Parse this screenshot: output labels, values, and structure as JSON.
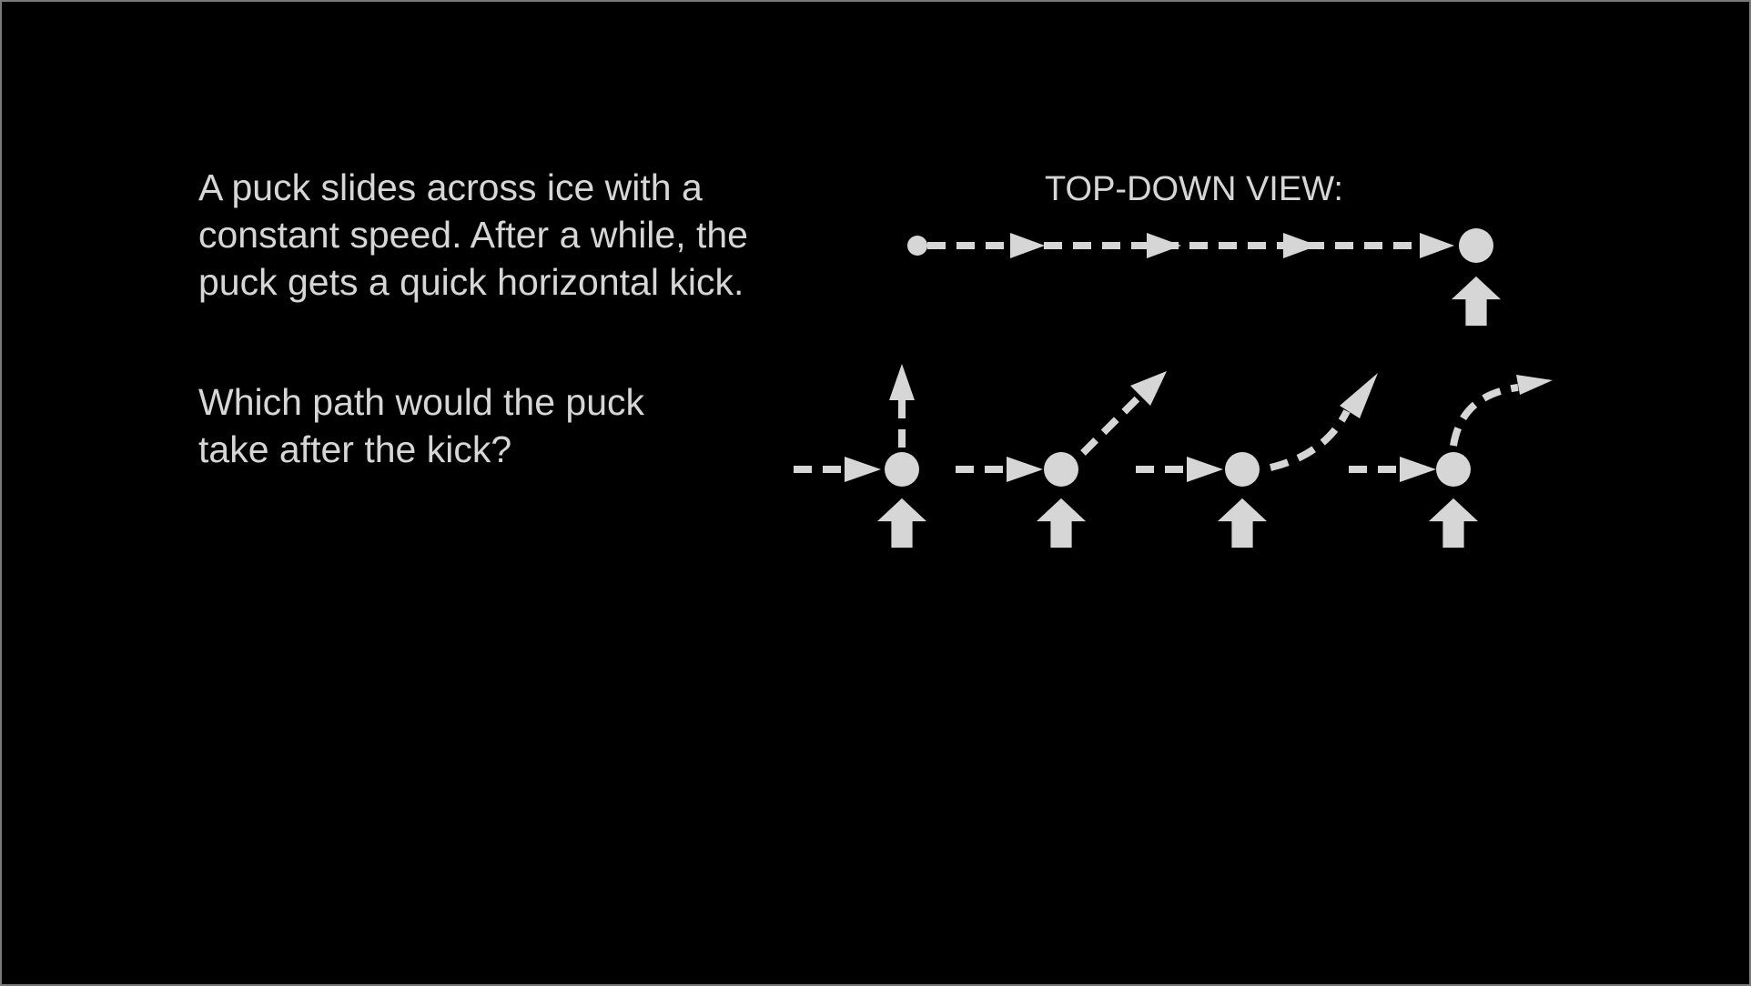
{
  "slide": {
    "description_lines": [
      "A puck slides across ice with a",
      "constant speed. After a while, the",
      "puck gets a quick horizontal kick."
    ],
    "question_lines": [
      "Which path would the puck",
      "take after the kick?"
    ],
    "view_label": "TOP-DOWN VIEW:"
  },
  "colors": {
    "background": "#000000",
    "foreground": "#d6d6d6"
  },
  "icons": [
    "puck-start-dot",
    "puck-icon",
    "kick-arrow-icon",
    "motion-arrowhead-icon"
  ]
}
